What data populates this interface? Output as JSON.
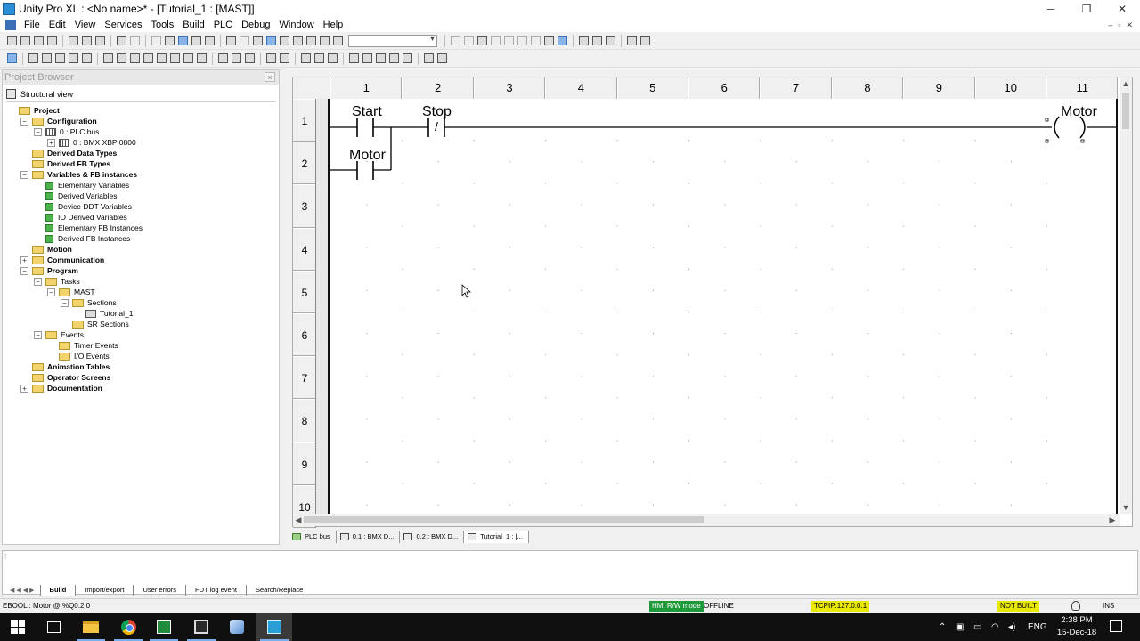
{
  "window": {
    "title": "Unity Pro XL : <No name>* - [Tutorial_1 : [MAST]]",
    "minimize": "─",
    "maximize": "❐",
    "close": "✕"
  },
  "menu": {
    "items": [
      "File",
      "Edit",
      "View",
      "Services",
      "Tools",
      "Build",
      "PLC",
      "Debug",
      "Window",
      "Help"
    ],
    "mdi_minimize": "–",
    "mdi_restore": "▫",
    "mdi_close": "✕"
  },
  "project_browser": {
    "title": "Project Browser",
    "close": "×",
    "view_label": "Structural view",
    "tree": [
      {
        "label": "Project",
        "bold": true,
        "icon": "folder",
        "expander": "",
        "depth": 0
      },
      {
        "label": "Configuration",
        "bold": true,
        "icon": "folder",
        "expander": "−",
        "depth": 1
      },
      {
        "label": "0 : PLC bus",
        "bold": false,
        "icon": "module",
        "expander": "−",
        "depth": 2
      },
      {
        "label": "0 : BMX XBP 0800",
        "bold": false,
        "icon": "module",
        "expander": "+",
        "depth": 3
      },
      {
        "label": "Derived Data Types",
        "bold": true,
        "icon": "folder",
        "expander": "",
        "depth": 1
      },
      {
        "label": "Derived FB Types",
        "bold": true,
        "icon": "folder",
        "expander": "",
        "depth": 1
      },
      {
        "label": "Variables & FB instances",
        "bold": true,
        "icon": "folder",
        "expander": "−",
        "depth": 1
      },
      {
        "label": "Elementary Variables",
        "bold": false,
        "icon": "var",
        "expander": "",
        "depth": 2
      },
      {
        "label": "Derived Variables",
        "bold": false,
        "icon": "var",
        "expander": "",
        "depth": 2
      },
      {
        "label": "Device DDT Variables",
        "bold": false,
        "icon": "var",
        "expander": "",
        "depth": 2
      },
      {
        "label": "IO Derived Variables",
        "bold": false,
        "icon": "var",
        "expander": "",
        "depth": 2
      },
      {
        "label": "Elementary FB Instances",
        "bold": false,
        "icon": "var",
        "expander": "",
        "depth": 2
      },
      {
        "label": "Derived FB Instances",
        "bold": false,
        "icon": "var",
        "expander": "",
        "depth": 2
      },
      {
        "label": "Motion",
        "bold": true,
        "icon": "folder",
        "expander": "",
        "depth": 1
      },
      {
        "label": "Communication",
        "bold": true,
        "icon": "folder",
        "expander": "+",
        "depth": 1
      },
      {
        "label": "Program",
        "bold": true,
        "icon": "folder",
        "expander": "−",
        "depth": 1
      },
      {
        "label": "Tasks",
        "bold": false,
        "icon": "folder",
        "expander": "−",
        "depth": 2
      },
      {
        "label": "MAST",
        "bold": false,
        "icon": "folder",
        "expander": "−",
        "depth": 3
      },
      {
        "label": "Sections",
        "bold": false,
        "icon": "folder",
        "expander": "−",
        "depth": 4
      },
      {
        "label": "Tutorial_1",
        "bold": false,
        "icon": "section",
        "expander": "",
        "depth": 5
      },
      {
        "label": "SR Sections",
        "bold": false,
        "icon": "folder",
        "expander": "",
        "depth": 4
      },
      {
        "label": "Events",
        "bold": false,
        "icon": "folder",
        "expander": "−",
        "depth": 2
      },
      {
        "label": "Timer Events",
        "bold": false,
        "icon": "folder",
        "expander": "",
        "depth": 3
      },
      {
        "label": "I/O Events",
        "bold": false,
        "icon": "folder",
        "expander": "",
        "depth": 3
      },
      {
        "label": "Animation Tables",
        "bold": true,
        "icon": "folder",
        "expander": "",
        "depth": 1
      },
      {
        "label": "Operator Screens",
        "bold": true,
        "icon": "folder",
        "expander": "",
        "depth": 1
      },
      {
        "label": "Documentation",
        "bold": true,
        "icon": "folder",
        "expander": "+",
        "depth": 1
      }
    ]
  },
  "ld_editor": {
    "columns": [
      "1",
      "2",
      "3",
      "4",
      "5",
      "6",
      "7",
      "8",
      "9",
      "10",
      "11"
    ],
    "rows": [
      "1",
      "2",
      "3",
      "4",
      "5",
      "6",
      "7",
      "8",
      "9",
      "10"
    ],
    "labels": {
      "start_contact": "Start",
      "stop_contact": "Stop",
      "stop_negation": "/",
      "motor_contact": "Motor",
      "motor_coil": "Motor"
    }
  },
  "doc_tabs": [
    {
      "label": "PLC bus",
      "icon": "plc-bus-icon",
      "active": false
    },
    {
      "label": "0.1 : BMX D...",
      "icon": "module-icon",
      "active": false
    },
    {
      "label": "0.2 : BMX D...",
      "icon": "module-icon",
      "active": false
    },
    {
      "label": "Tutorial_1 : [...",
      "icon": "ld-section-icon",
      "active": true
    }
  ],
  "output": {
    "tabs": [
      "Build",
      "Import/export",
      "User errors",
      "FDT log event",
      "Search/Replace"
    ],
    "active_tab": "Build"
  },
  "status": {
    "variable_info": "EBOOL : Motor @ %Q0.2.0",
    "hmi_mode": "HMI R/W mode",
    "connection": "OFFLINE",
    "address": "TCPIP:127.0.0.1",
    "build_state": "NOT BUILT",
    "insert_mode": "INS"
  },
  "taskbar": {
    "tray_language": "ENG",
    "time": "2:38 PM",
    "date": "15-Dec-18"
  },
  "colors": {
    "status_highlight": "#e8e800",
    "hmi_green": "#1e9a3a",
    "folder_yellow": "#f3d36b",
    "var_green": "#4cb24c"
  }
}
